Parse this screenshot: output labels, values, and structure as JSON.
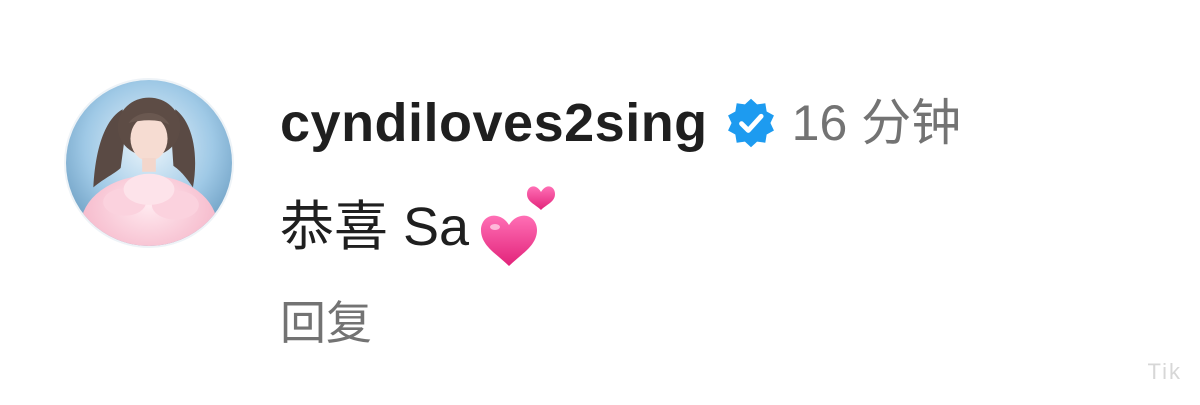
{
  "comment": {
    "username": "cyndiloves2sing",
    "timestamp": "16 分钟",
    "text": "恭喜 Sa",
    "emoji_icon": "two-hearts-icon",
    "verified_icon": "verified-badge-icon",
    "reply_label": "回复"
  },
  "watermark": "Tik",
  "colors": {
    "username": "#1f1f1f",
    "meta": "#737373",
    "verified": "#1d9bf0",
    "heart": "#f0328c"
  }
}
